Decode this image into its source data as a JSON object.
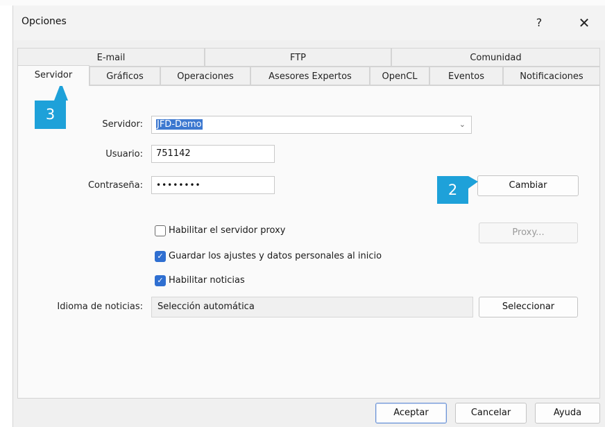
{
  "window": {
    "title": "Opciones",
    "help_label": "?",
    "close_label": "✕"
  },
  "tabs_row1": [
    "E-mail",
    "FTP",
    "Comunidad"
  ],
  "tabs_row2": [
    "Servidor",
    "Gráficos",
    "Operaciones",
    "Asesores Expertos",
    "OpenCL",
    "Eventos",
    "Notificaciones"
  ],
  "active_tab": "Servidor",
  "form": {
    "server_label": "Servidor:",
    "server_value": "JFD-Demo",
    "user_label": "Usuario:",
    "user_value": "751142",
    "password_label": "Contraseña:",
    "password_value": "••••••••",
    "change_button": "Cambiar",
    "proxy_checkbox": {
      "label": "Habilitar el servidor proxy",
      "checked": false
    },
    "proxy_button": "Proxy...",
    "save_settings_checkbox": {
      "label": "Guardar los ajustes y datos personales al inicio",
      "checked": true
    },
    "news_checkbox": {
      "label": "Habilitar noticias",
      "checked": true
    },
    "news_language_label": "Idioma de noticias:",
    "news_language_value": "Selección automática",
    "select_button": "Seleccionar"
  },
  "footer": {
    "ok": "Aceptar",
    "cancel": "Cancelar",
    "help": "Ayuda"
  },
  "annotations": {
    "callout_2": "2",
    "callout_3": "3",
    "callout_color": "#1ea1d9"
  }
}
